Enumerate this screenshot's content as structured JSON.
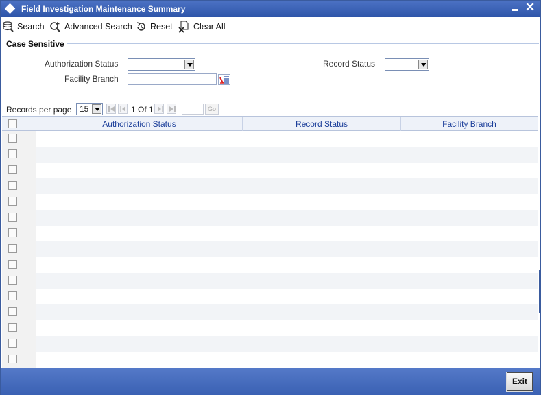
{
  "window": {
    "title": "Field Investigation Maintenance Summary"
  },
  "toolbar": {
    "search_label": "Search",
    "advanced_search_label": "Advanced Search",
    "reset_label": "Reset",
    "clear_all_label": "Clear All"
  },
  "criteria": {
    "section_title": "Case Sensitive",
    "authorization_status_label": "Authorization Status",
    "authorization_status_value": "",
    "record_status_label": "Record Status",
    "record_status_value": "",
    "facility_branch_label": "Facility Branch",
    "facility_branch_value": ""
  },
  "pager": {
    "records_per_page_label": "Records per page",
    "records_per_page_value": "15",
    "page_indicator": "1 Of 1",
    "goto_value": "",
    "go_label": "Go"
  },
  "grid": {
    "columns": [
      "Authorization Status",
      "Record Status",
      "Facility Branch"
    ],
    "row_count": 15
  },
  "footer": {
    "exit_label": "Exit"
  },
  "colors": {
    "titlebar": "#3a60b5",
    "footer": "#4a70c0",
    "header_text": "#1c3f9a"
  }
}
